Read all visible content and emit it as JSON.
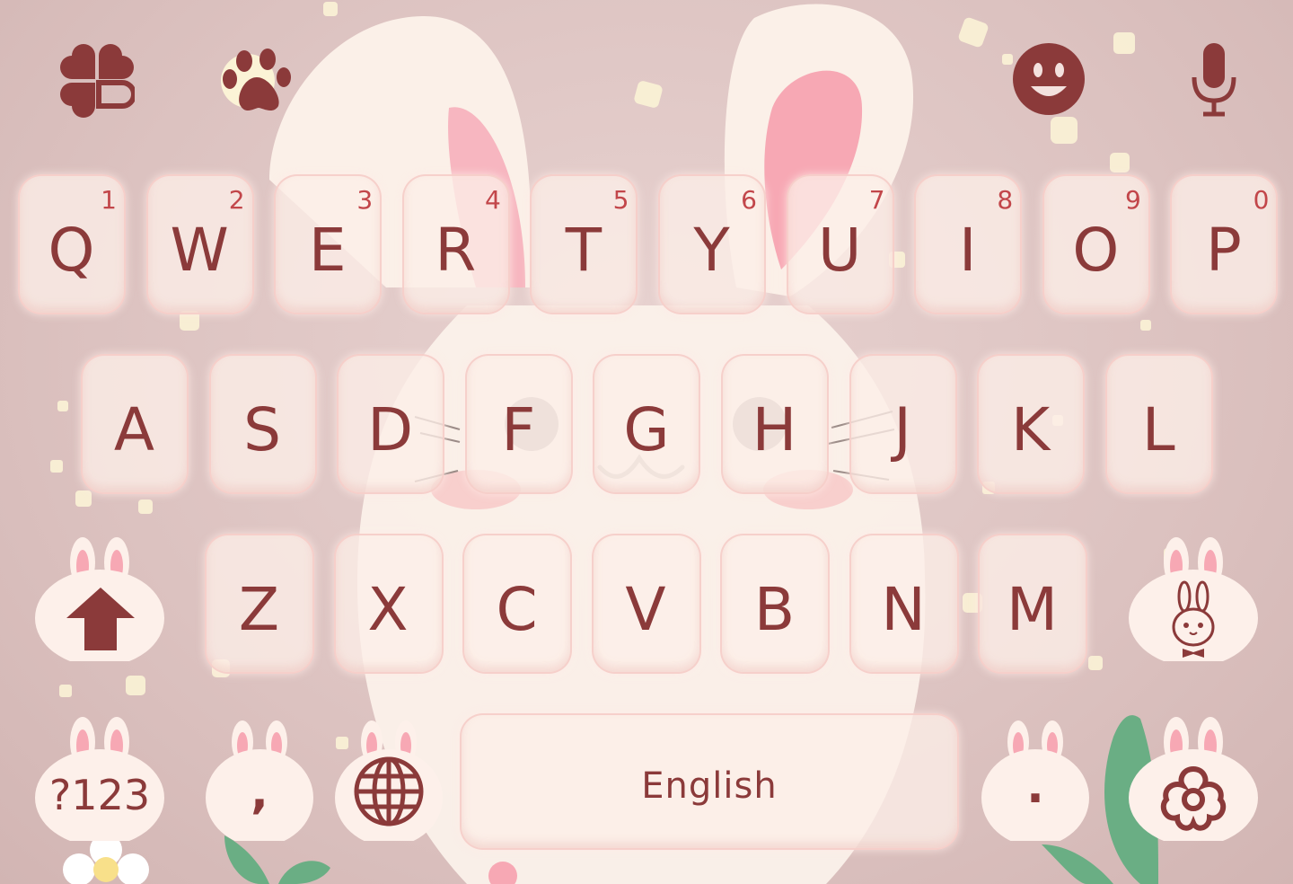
{
  "toolbar": {
    "left_icons": [
      "clover-icon",
      "paw-icon"
    ],
    "right_icons": [
      "emoji-icon",
      "microphone-icon"
    ]
  },
  "keyboard": {
    "row1": [
      {
        "letter": "Q",
        "hint": "1"
      },
      {
        "letter": "W",
        "hint": "2"
      },
      {
        "letter": "E",
        "hint": "3"
      },
      {
        "letter": "R",
        "hint": "4"
      },
      {
        "letter": "T",
        "hint": "5"
      },
      {
        "letter": "Y",
        "hint": "6"
      },
      {
        "letter": "U",
        "hint": "7"
      },
      {
        "letter": "I",
        "hint": "8"
      },
      {
        "letter": "O",
        "hint": "9"
      },
      {
        "letter": "P",
        "hint": "0"
      }
    ],
    "row2": [
      "A",
      "S",
      "D",
      "F",
      "G",
      "H",
      "J",
      "K",
      "L"
    ],
    "row3": [
      "Z",
      "X",
      "C",
      "V",
      "B",
      "N",
      "M"
    ],
    "symbols_label": "?123",
    "comma_label": ",",
    "space_label": "English",
    "period_label": ".",
    "icons": {
      "shift": "shift-arrow-icon",
      "bunny": "bunny-icon",
      "globe": "globe-icon",
      "settings": "flower-settings-icon"
    }
  },
  "colors": {
    "key_text": "#8b3a3a",
    "hint_text": "#c2464a",
    "background": "#dcc2c0",
    "key_fill": "#fdeee8"
  }
}
